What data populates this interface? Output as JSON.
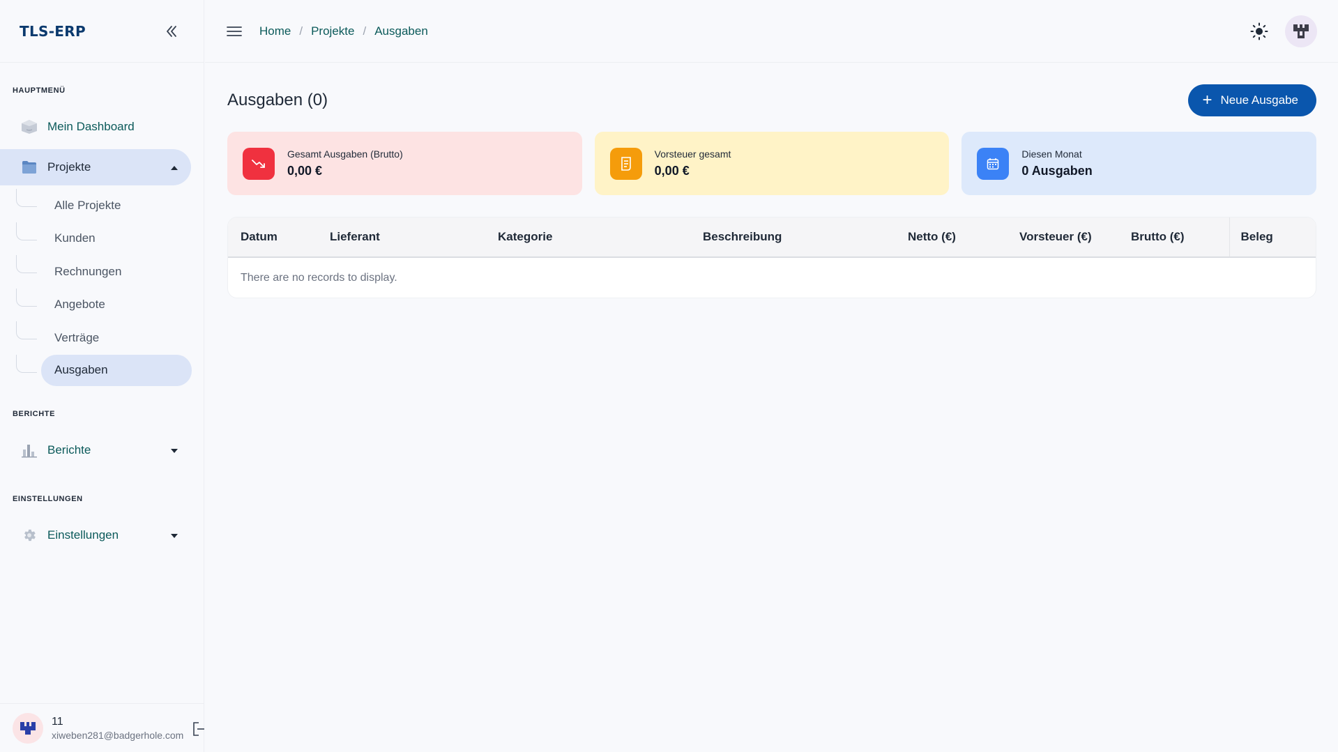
{
  "app": {
    "brand": "TLS-ERP"
  },
  "sidebar": {
    "sections": {
      "main": "HAUPTMENÜ",
      "reports": "BERICHTE",
      "settings": "EINSTELLUNGEN"
    },
    "items": {
      "dashboard": "Mein Dashboard",
      "projects": "Projekte",
      "reports": "Berichte",
      "settings": "Einstellungen"
    },
    "sub_items": [
      "Alle Projekte",
      "Kunden",
      "Rechnungen",
      "Angebote",
      "Verträge",
      "Ausgaben"
    ],
    "active_sub": "Ausgaben"
  },
  "user": {
    "name": "11",
    "email": "xiweben281@badgerhole.com"
  },
  "breadcrumb": {
    "home": "Home",
    "projects": "Projekte",
    "current": "Ausgaben",
    "separator": "/"
  },
  "page": {
    "title": "Ausgaben (0)",
    "new_button": "Neue Ausgabe",
    "plus": "+"
  },
  "cards": [
    {
      "label": "Gesamt Ausgaben (Brutto)",
      "value": "0,00 €",
      "bg": "#fde3e3",
      "icon_bg": "#f0313f",
      "icon": "trending-down-icon"
    },
    {
      "label": "Vorsteuer gesamt",
      "value": "0,00 €",
      "bg": "#fff3c7",
      "icon_bg": "#f59c0b",
      "icon": "receipt-icon"
    },
    {
      "label": "Diesen Monat",
      "value": "0 Ausgaben",
      "bg": "#dde9fb",
      "icon_bg": "#3b82f6",
      "icon": "calendar-icon"
    }
  ],
  "table": {
    "columns": [
      "Datum",
      "Lieferant",
      "Kategorie",
      "Beschreibung",
      "Netto (€)",
      "Vorsteuer (€)",
      "Brutto (€)",
      "Beleg"
    ],
    "empty_message": "There are no records to display."
  },
  "colors": {
    "accent": "#0a56ad",
    "brand": "#0b3a6e",
    "link": "#0b5a5a",
    "active_bg": "#dbe4f7"
  }
}
